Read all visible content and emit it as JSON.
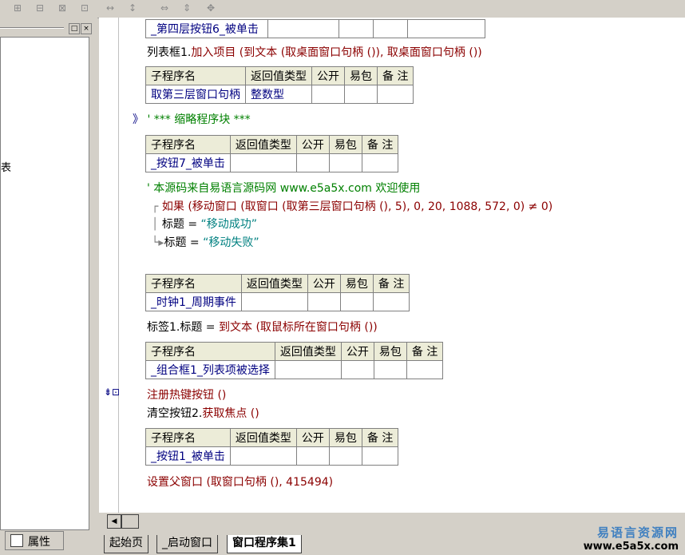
{
  "toolbar": {
    "icons": [
      "table-icon",
      "table-icon",
      "table-icon",
      "table-icon",
      "column-width-icon",
      "row-height-icon",
      "column-icon",
      "row-icon",
      "grid-icon"
    ]
  },
  "left_panel": {
    "edge_char": "表",
    "properties_label": "属性"
  },
  "code": {
    "line1_cell": "_第四层按钮6_被单击",
    "line2_pre": "列表框1.",
    "line2_call": "加入项目 (到文本 (取桌面窗口句柄 ()), 取桌面窗口句柄 ())",
    "table1": {
      "headers": [
        "子程序名",
        "返回值类型",
        "公开",
        "易包",
        "备 注"
      ],
      "row": [
        "取第三层窗口句柄",
        "整数型",
        "",
        "",
        ""
      ]
    },
    "collapsed_marker": "》",
    "collapsed_text": "' *** 缩略程序块 ***",
    "table2": {
      "headers": [
        "子程序名",
        "返回值类型",
        "公开",
        "易包",
        "备 注"
      ],
      "row": [
        "_按钮7_被单击",
        "",
        "",
        "",
        ""
      ]
    },
    "comment": "' 本源码来自易语言源码网 www.e5a5x.com  欢迎使用",
    "if_line": "如果 (移动窗口 (取窗口 (取第三层窗口句柄 (), 5), 0, 20, 1088, 572, 0) ≠ 0)",
    "title_kw": "标题",
    "eq": "=",
    "title1": "“移动成功”",
    "title2": "“移动失败”",
    "table3": {
      "headers": [
        "子程序名",
        "返回值类型",
        "公开",
        "易包",
        "备 注"
      ],
      "row": [
        "_时钟1_周期事件",
        "",
        "",
        "",
        ""
      ]
    },
    "label_line_pre": "标签1.标题 =",
    "label_line_call": "到文本 (取鼠标所在窗口句柄 ())",
    "table4": {
      "headers": [
        "子程序名",
        "返回值类型",
        "公开",
        "易包",
        "备 注"
      ],
      "row": [
        "_组合框1_列表项被选择",
        "",
        "",
        "",
        ""
      ]
    },
    "hotkey_line": "注册热键按钮 ()",
    "clear_pre": "清空按钮2.",
    "clear_call": "获取焦点 ()",
    "table5": {
      "headers": [
        "子程序名",
        "返回值类型",
        "公开",
        "易包",
        "备 注"
      ],
      "row": [
        "_按钮1_被单击",
        "",
        "",
        "",
        ""
      ]
    },
    "parent_line": "设置父窗口 (取窗口句柄 (), 415494)"
  },
  "tabs": [
    "起始页",
    "_启动窗口",
    "窗口程序集1"
  ],
  "watermark": {
    "line1": "易语言资源网",
    "line2": "www.e5a5x.com"
  }
}
